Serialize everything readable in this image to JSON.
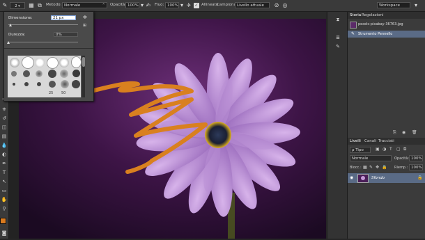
{
  "options_bar": {
    "brush_size": "2",
    "mode_label": "Metodo:",
    "mode_value": "Normale",
    "opacity_label": "Opacità:",
    "opacity_value": "100%",
    "flow_label": "Fluo:",
    "flow_value": "100%",
    "smoothing_label": "Allineato",
    "sample_label": "Campiona:",
    "sample_value": "Livello attuale",
    "workspace_value": "Workspace"
  },
  "brush_popup": {
    "size_label": "Dimensione:",
    "size_value": "21 px",
    "hardness_label": "Durezza:",
    "hardness_value": "0%",
    "size_fraction": 0.06,
    "hardness_fraction": 0.0,
    "preset_numbers": [
      "25",
      "50"
    ]
  },
  "history_panel": {
    "tab_history": "Storia",
    "tab_adjust": "Regolazioni",
    "snapshot_name": "pexels-pixabay-36763.jpg",
    "step_name": "Strumento Pennello"
  },
  "layers_panel": {
    "tab_layers": "Livelli",
    "tab_channels": "Canali",
    "tab_paths": "Tracciati",
    "filter_label": "ρ Tipo",
    "blend_value": "Normale",
    "opacity_label": "Opacità:",
    "opacity_value": "100%",
    "lock_label": "Blocc.:",
    "fill_label": "Riemp.:",
    "fill_value": "100%",
    "layer_name": "Sfondo"
  },
  "colors": {
    "foreground": "#d97a1e",
    "background": "#ffffff",
    "brush_stroke": "#d9801f",
    "selected_row": "#5a6b86"
  }
}
